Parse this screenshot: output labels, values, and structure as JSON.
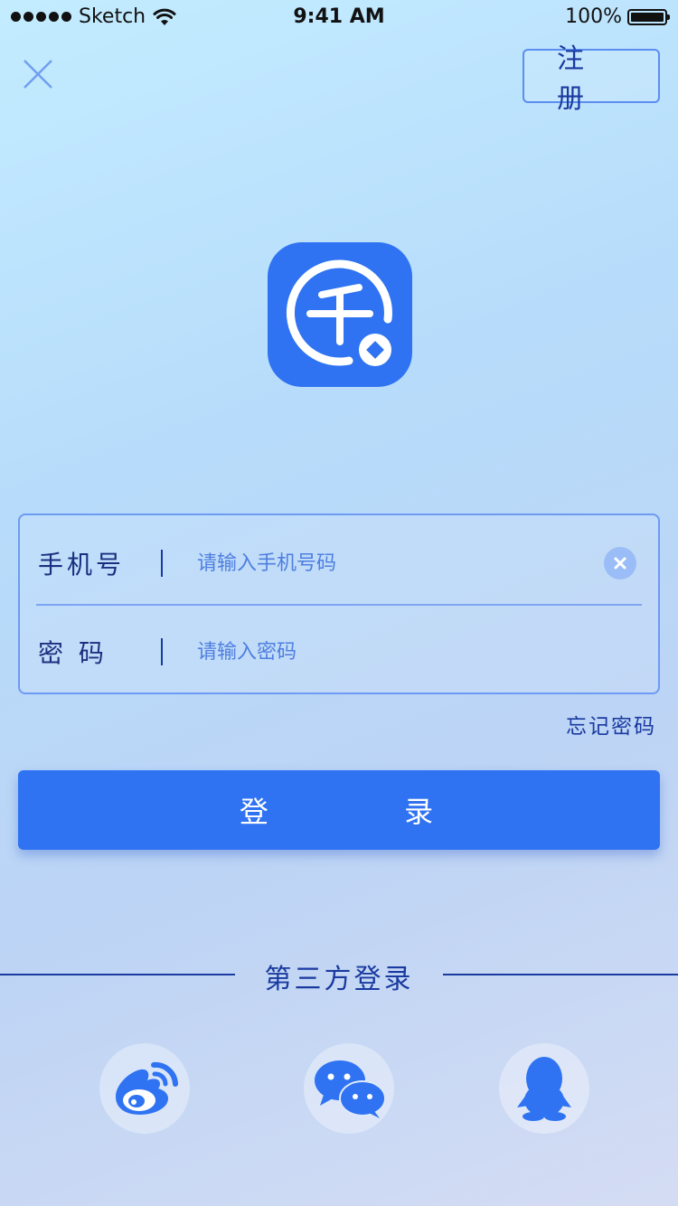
{
  "status_bar": {
    "carrier": "Sketch",
    "time": "9:41 AM",
    "battery": "100%"
  },
  "header": {
    "register_label": "注 册"
  },
  "form": {
    "phone_label": "手机号",
    "phone_placeholder": "请输入手机号码",
    "password_label": "密 码",
    "password_placeholder": "请输入密码"
  },
  "forgot_password": "忘记密码",
  "login_label": "登 录",
  "third_party": {
    "title": "第三方登录",
    "providers": [
      "weibo-icon",
      "wechat-icon",
      "qq-icon"
    ]
  },
  "colors": {
    "accent": "#2f73f2",
    "text_dark_blue": "#1a3aa0"
  }
}
